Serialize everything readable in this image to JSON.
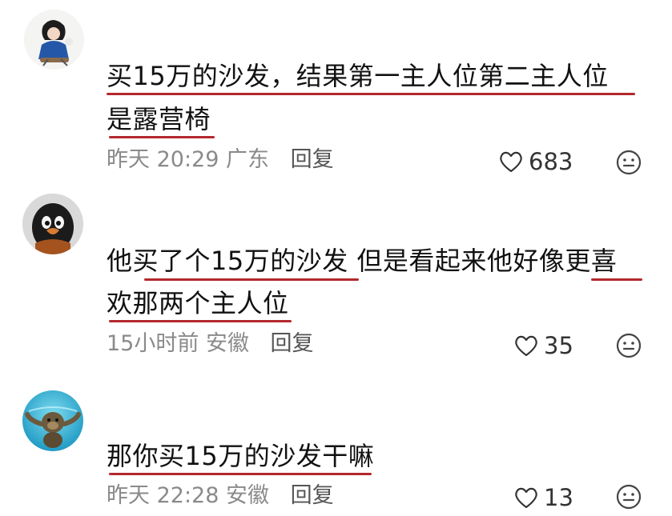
{
  "comments": [
    {
      "lines": [
        "买15万的沙发，结果第一主人位第二主人位",
        "是露营椅"
      ],
      "time": "昨天 20:29",
      "location": "广东",
      "reply_label": "回复",
      "likes": "683"
    },
    {
      "lines": [
        "他买了个15万的沙发 但是看起来他好像更喜",
        "欢那两个主人位"
      ],
      "time": "15小时前",
      "location": "安徽",
      "reply_label": "回复",
      "likes": "35"
    },
    {
      "lines": [
        "那你买15万的沙发干嘛"
      ],
      "time": "昨天 22:28",
      "location": "安徽",
      "reply_label": "回复",
      "likes": "13"
    }
  ],
  "colors": {
    "underline": "#b4282d",
    "meta_text": "#8a8a8a"
  },
  "icons": {
    "like": "heart-outline-icon",
    "react": "smiley-icon"
  }
}
